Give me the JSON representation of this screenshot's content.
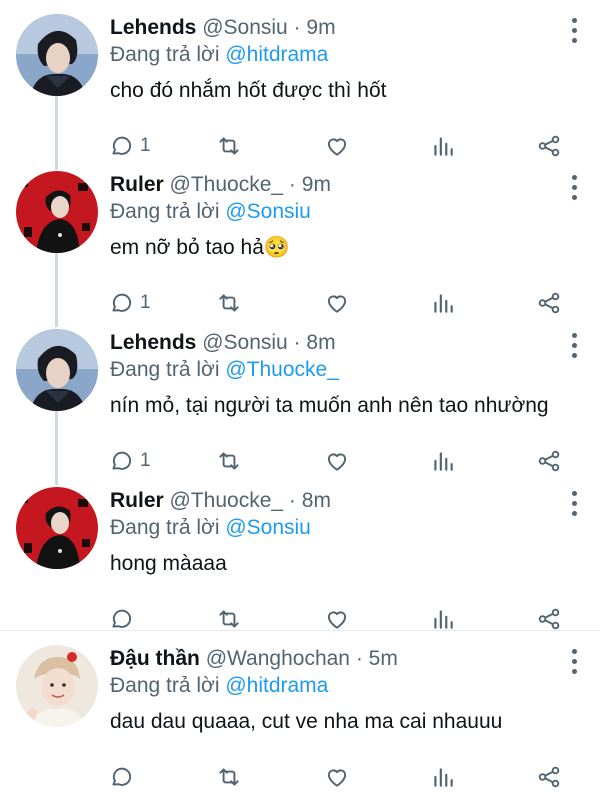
{
  "tweets": [
    {
      "name": "Lehends",
      "handle": "@Sonsiu",
      "time": "9m",
      "reply_prefix": "Đang trả lời",
      "reply_to": "@hitdrama",
      "text": "cho đó nhắm hốt được thì hốt",
      "reply_count": "1",
      "avatar": "lehends"
    },
    {
      "name": "Ruler",
      "handle": "@Thuocke_",
      "time": "9m",
      "reply_prefix": "Đang trả lời",
      "reply_to": "@Sonsiu",
      "text": "em nỡ bỏ tao hả🥺",
      "reply_count": "1",
      "avatar": "ruler"
    },
    {
      "name": "Lehends",
      "handle": "@Sonsiu",
      "time": "8m",
      "reply_prefix": "Đang trả lời",
      "reply_to": "@Thuocke_",
      "text": "nín mỏ, tại người ta muốn anh nên tao nhường",
      "reply_count": "1",
      "avatar": "lehends"
    },
    {
      "name": "Ruler",
      "handle": "@Thuocke_",
      "time": "8m",
      "reply_prefix": "Đang trả lời",
      "reply_to": "@Sonsiu",
      "text": "hong màaaa",
      "reply_count": "",
      "avatar": "ruler"
    },
    {
      "name": "Đậu thần",
      "handle": "@Wanghochan",
      "time": "5m",
      "reply_prefix": "Đang trả lời",
      "reply_to": "@hitdrama",
      "text": "dau dau quaaa, cut ve nha ma cai nhauuu",
      "reply_count": "",
      "avatar": "dauthan"
    }
  ],
  "separator": "·",
  "colors": {
    "accent": "#1d9bf0",
    "secondary_text": "#536471",
    "thread_line": "#cfd9de"
  },
  "icons": {
    "reply": "reply-icon",
    "retweet": "retweet-icon",
    "like": "heart-icon",
    "analytics": "analytics-icon",
    "share": "share-icon",
    "more": "more-icon"
  }
}
